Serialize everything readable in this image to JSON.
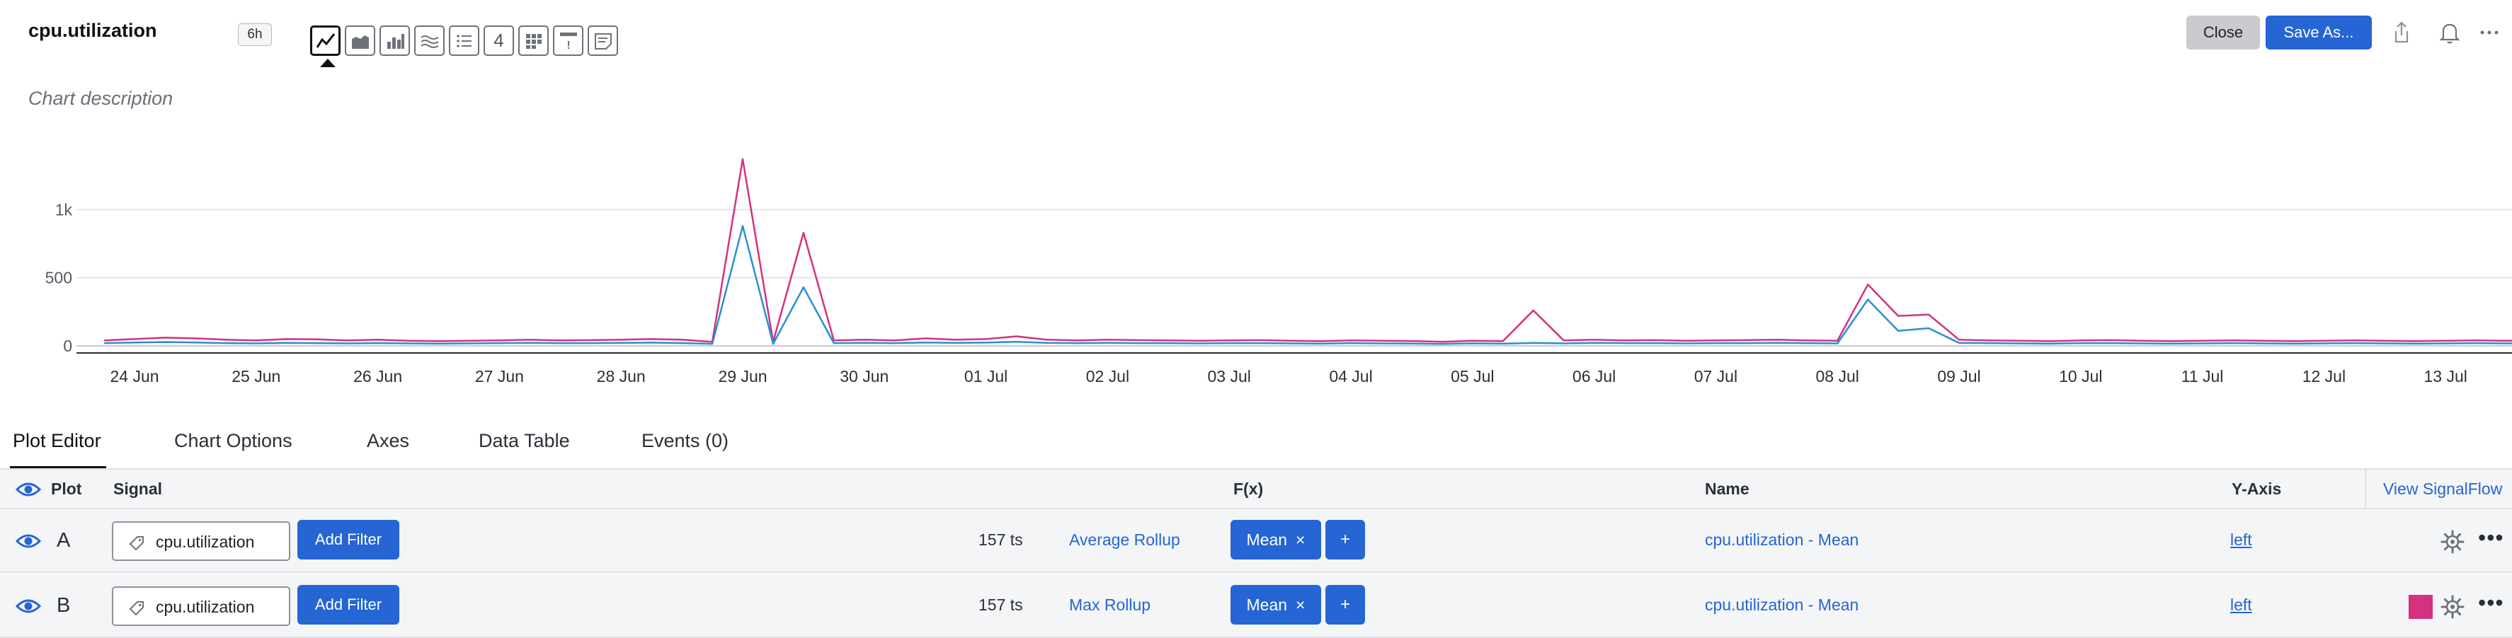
{
  "header": {
    "title": "cpu.utilization",
    "time_range": "6h",
    "description": "Chart description",
    "viz_types": [
      {
        "icon": "line-chart-icon",
        "text": ""
      },
      {
        "icon": "area-chart-icon",
        "text": ""
      },
      {
        "icon": "column-chart-icon",
        "text": ""
      },
      {
        "icon": "histogram-icon",
        "text": ""
      },
      {
        "icon": "list-icon",
        "text": ""
      },
      {
        "icon": "single-value-icon",
        "text": "4"
      },
      {
        "icon": "heatmap-icon",
        "text": ""
      },
      {
        "icon": "event-feed-icon",
        "text": "!"
      },
      {
        "icon": "text-note-icon",
        "text": ""
      }
    ],
    "close_label": "Close",
    "save_label": "Save As...",
    "icons": [
      "share-icon",
      "bell-icon",
      "more-icon"
    ]
  },
  "chart_data": {
    "type": "line",
    "title": "",
    "xlabel": "",
    "ylabel": "",
    "x_ticks": [
      "24 Jun",
      "25 Jun",
      "26 Jun",
      "27 Jun",
      "28 Jun",
      "29 Jun",
      "30 Jun",
      "01 Jul",
      "02 Jul",
      "03 Jul",
      "04 Jul",
      "05 Jul",
      "06 Jul",
      "07 Jul",
      "08 Jul",
      "09 Jul",
      "10 Jul",
      "11 Jul",
      "12 Jul",
      "13 Jul"
    ],
    "y_ticks": [
      "0",
      "500",
      "1k"
    ],
    "ylim": [
      0,
      1500
    ],
    "grid": true,
    "legend": "none",
    "series": [
      {
        "color": "#d4317f",
        "points": [
          [
            "23 Jun 18:00",
            40
          ],
          [
            "24 Jun 00:00",
            50
          ],
          [
            "24 Jun 06:00",
            60
          ],
          [
            "24 Jun 12:00",
            55
          ],
          [
            "24 Jun 18:00",
            45
          ],
          [
            "25 Jun 00:00",
            40
          ],
          [
            "25 Jun 06:00",
            50
          ],
          [
            "25 Jun 12:00",
            48
          ],
          [
            "25 Jun 18:00",
            40
          ],
          [
            "26 Jun 00:00",
            45
          ],
          [
            "26 Jun 06:00",
            38
          ],
          [
            "26 Jun 12:00",
            35
          ],
          [
            "26 Jun 18:00",
            38
          ],
          [
            "27 Jun 00:00",
            40
          ],
          [
            "27 Jun 06:00",
            45
          ],
          [
            "27 Jun 12:00",
            40
          ],
          [
            "27 Jun 18:00",
            42
          ],
          [
            "28 Jun 00:00",
            45
          ],
          [
            "28 Jun 06:00",
            50
          ],
          [
            "28 Jun 12:00",
            45
          ],
          [
            "28 Jun 18:00",
            30
          ],
          [
            "29 Jun 00:00",
            1370
          ],
          [
            "29 Jun 06:00",
            30
          ],
          [
            "29 Jun 12:00",
            830
          ],
          [
            "29 Jun 18:00",
            40
          ],
          [
            "30 Jun 00:00",
            45
          ],
          [
            "30 Jun 06:00",
            40
          ],
          [
            "30 Jun 12:00",
            55
          ],
          [
            "30 Jun 18:00",
            45
          ],
          [
            "01 Jul 00:00",
            50
          ],
          [
            "01 Jul 06:00",
            70
          ],
          [
            "01 Jul 12:00",
            45
          ],
          [
            "01 Jul 18:00",
            40
          ],
          [
            "02 Jul 00:00",
            45
          ],
          [
            "02 Jul 06:00",
            42
          ],
          [
            "02 Jul 12:00",
            40
          ],
          [
            "02 Jul 18:00",
            38
          ],
          [
            "03 Jul 00:00",
            40
          ],
          [
            "03 Jul 06:00",
            42
          ],
          [
            "03 Jul 12:00",
            38
          ],
          [
            "03 Jul 18:00",
            35
          ],
          [
            "04 Jul 00:00",
            40
          ],
          [
            "04 Jul 06:00",
            38
          ],
          [
            "04 Jul 12:00",
            36
          ],
          [
            "04 Jul 18:00",
            30
          ],
          [
            "05 Jul 00:00",
            38
          ],
          [
            "05 Jul 06:00",
            35
          ],
          [
            "05 Jul 12:00",
            260
          ],
          [
            "05 Jul 18:00",
            40
          ],
          [
            "06 Jul 00:00",
            45
          ],
          [
            "06 Jul 06:00",
            40
          ],
          [
            "06 Jul 12:00",
            42
          ],
          [
            "06 Jul 18:00",
            38
          ],
          [
            "07 Jul 00:00",
            40
          ],
          [
            "07 Jul 06:00",
            42
          ],
          [
            "07 Jul 12:00",
            45
          ],
          [
            "07 Jul 18:00",
            40
          ],
          [
            "08 Jul 00:00",
            38
          ],
          [
            "08 Jul 06:00",
            450
          ],
          [
            "08 Jul 12:00",
            220
          ],
          [
            "08 Jul 18:00",
            230
          ],
          [
            "09 Jul 00:00",
            45
          ],
          [
            "09 Jul 06:00",
            40
          ],
          [
            "09 Jul 12:00",
            38
          ],
          [
            "09 Jul 18:00",
            35
          ],
          [
            "10 Jul 00:00",
            40
          ],
          [
            "10 Jul 06:00",
            42
          ],
          [
            "10 Jul 12:00",
            38
          ],
          [
            "10 Jul 18:00",
            35
          ],
          [
            "11 Jul 00:00",
            38
          ],
          [
            "11 Jul 06:00",
            40
          ],
          [
            "11 Jul 12:00",
            38
          ],
          [
            "11 Jul 18:00",
            35
          ],
          [
            "12 Jul 00:00",
            38
          ],
          [
            "12 Jul 06:00",
            40
          ],
          [
            "12 Jul 12:00",
            38
          ],
          [
            "12 Jul 18:00",
            35
          ],
          [
            "13 Jul 00:00",
            38
          ],
          [
            "13 Jul 06:00",
            40
          ],
          [
            "13 Jul 12:00",
            38
          ],
          [
            "13 Jul 18:00",
            40
          ]
        ]
      },
      {
        "color": "#2a8fd0",
        "points": [
          [
            "23 Jun 18:00",
            20
          ],
          [
            "24 Jun 00:00",
            25
          ],
          [
            "24 Jun 06:00",
            28
          ],
          [
            "24 Jun 12:00",
            25
          ],
          [
            "24 Jun 18:00",
            20
          ],
          [
            "25 Jun 00:00",
            18
          ],
          [
            "25 Jun 06:00",
            22
          ],
          [
            "25 Jun 12:00",
            20
          ],
          [
            "25 Jun 18:00",
            18
          ],
          [
            "26 Jun 00:00",
            20
          ],
          [
            "26 Jun 06:00",
            18
          ],
          [
            "26 Jun 12:00",
            16
          ],
          [
            "26 Jun 18:00",
            18
          ],
          [
            "27 Jun 00:00",
            20
          ],
          [
            "27 Jun 06:00",
            22
          ],
          [
            "27 Jun 12:00",
            20
          ],
          [
            "27 Jun 18:00",
            20
          ],
          [
            "28 Jun 00:00",
            22
          ],
          [
            "28 Jun 06:00",
            24
          ],
          [
            "28 Jun 12:00",
            20
          ],
          [
            "28 Jun 18:00",
            15
          ],
          [
            "29 Jun 00:00",
            880
          ],
          [
            "29 Jun 06:00",
            15
          ],
          [
            "29 Jun 12:00",
            430
          ],
          [
            "29 Jun 18:00",
            20
          ],
          [
            "30 Jun 00:00",
            22
          ],
          [
            "30 Jun 06:00",
            20
          ],
          [
            "30 Jun 12:00",
            25
          ],
          [
            "30 Jun 18:00",
            22
          ],
          [
            "01 Jul 00:00",
            24
          ],
          [
            "01 Jul 06:00",
            30
          ],
          [
            "01 Jul 12:00",
            22
          ],
          [
            "01 Jul 18:00",
            20
          ],
          [
            "02 Jul 00:00",
            22
          ],
          [
            "02 Jul 06:00",
            20
          ],
          [
            "02 Jul 12:00",
            20
          ],
          [
            "02 Jul 18:00",
            18
          ],
          [
            "03 Jul 00:00",
            20
          ],
          [
            "03 Jul 06:00",
            20
          ],
          [
            "03 Jul 12:00",
            18
          ],
          [
            "03 Jul 18:00",
            16
          ],
          [
            "04 Jul 00:00",
            20
          ],
          [
            "04 Jul 06:00",
            18
          ],
          [
            "04 Jul 12:00",
            17
          ],
          [
            "04 Jul 18:00",
            14
          ],
          [
            "05 Jul 00:00",
            18
          ],
          [
            "05 Jul 06:00",
            16
          ],
          [
            "05 Jul 12:00",
            22
          ],
          [
            "05 Jul 18:00",
            18
          ],
          [
            "06 Jul 00:00",
            22
          ],
          [
            "06 Jul 06:00",
            20
          ],
          [
            "06 Jul 12:00",
            20
          ],
          [
            "06 Jul 18:00",
            18
          ],
          [
            "07 Jul 00:00",
            20
          ],
          [
            "07 Jul 06:00",
            20
          ],
          [
            "07 Jul 12:00",
            22
          ],
          [
            "07 Jul 18:00",
            20
          ],
          [
            "08 Jul 00:00",
            18
          ],
          [
            "08 Jul 06:00",
            340
          ],
          [
            "08 Jul 12:00",
            110
          ],
          [
            "08 Jul 18:00",
            130
          ],
          [
            "09 Jul 00:00",
            22
          ],
          [
            "09 Jul 06:00",
            20
          ],
          [
            "09 Jul 12:00",
            18
          ],
          [
            "09 Jul 18:00",
            16
          ],
          [
            "10 Jul 00:00",
            20
          ],
          [
            "10 Jul 06:00",
            20
          ],
          [
            "10 Jul 12:00",
            18
          ],
          [
            "10 Jul 18:00",
            16
          ],
          [
            "11 Jul 00:00",
            18
          ],
          [
            "11 Jul 06:00",
            20
          ],
          [
            "11 Jul 12:00",
            18
          ],
          [
            "11 Jul 18:00",
            16
          ],
          [
            "12 Jul 00:00",
            18
          ],
          [
            "12 Jul 06:00",
            20
          ],
          [
            "12 Jul 12:00",
            18
          ],
          [
            "12 Jul 18:00",
            16
          ],
          [
            "13 Jul 00:00",
            18
          ],
          [
            "13 Jul 06:00",
            20
          ],
          [
            "13 Jul 12:00",
            18
          ],
          [
            "13 Jul 18:00",
            20
          ]
        ]
      }
    ]
  },
  "tabs": [
    "Plot Editor",
    "Chart Options",
    "Axes",
    "Data Table",
    "Events (0)"
  ],
  "table": {
    "headers": {
      "plot": "Plot",
      "signal": "Signal",
      "fx": "F(x)",
      "name": "Name",
      "yaxis": "Y-Axis",
      "view_signalflow": "View SignalFlow"
    },
    "rows": [
      {
        "letter": "A",
        "signal": "cpu.utilization",
        "add_filter": "Add Filter",
        "ts": "157 ts",
        "rollup": "Average Rollup",
        "fx": "Mean",
        "fx_remove": "×",
        "fx_add": "+",
        "name": "cpu.utilization - Mean",
        "axis": "left",
        "color": ""
      },
      {
        "letter": "B",
        "signal": "cpu.utilization",
        "add_filter": "Add Filter",
        "ts": "157 ts",
        "rollup": "Max Rollup",
        "fx": "Mean",
        "fx_remove": "×",
        "fx_add": "+",
        "name": "cpu.utilization - Mean",
        "axis": "left",
        "color": "#d4317f"
      }
    ],
    "more_label": "•••"
  }
}
